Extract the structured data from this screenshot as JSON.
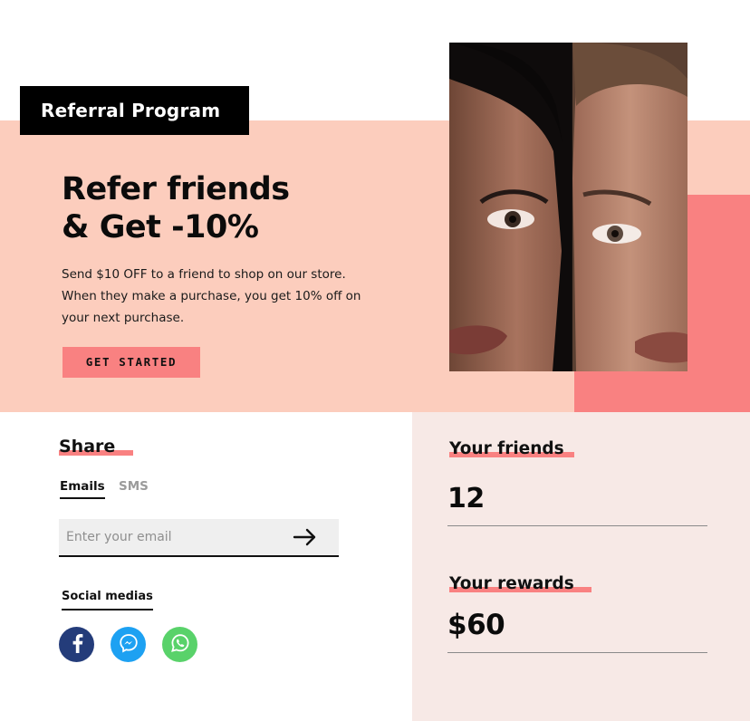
{
  "hero": {
    "tag": "Referral Program",
    "title_line1": "Refer friends",
    "title_line2": "& Get -10%",
    "desc_line1": "Send $10 OFF to a friend to shop on our store.",
    "desc_line2": "When they make a purchase, you get 10% off on",
    "desc_line3": "your next purchase.",
    "cta_label": "GET STARTED",
    "photo_icon": "two-women-portrait"
  },
  "share": {
    "title": "Share",
    "tabs": [
      "Emails",
      "SMS"
    ],
    "active_tab": "Emails",
    "email_placeholder": "Enter your email",
    "submit_icon": "arrow-right-icon",
    "social_title": "Social medias",
    "socials": [
      {
        "name": "facebook",
        "icon": "facebook-icon",
        "color": "#243c7a"
      },
      {
        "name": "messenger",
        "icon": "messenger-icon",
        "color": "#1da1f2"
      },
      {
        "name": "whatsapp",
        "icon": "whatsapp-icon",
        "color": "#59d26a"
      }
    ]
  },
  "stats": {
    "friends_label": "Your friends",
    "friends_value": "12",
    "rewards_label": "Your rewards",
    "rewards_value": "$60"
  },
  "colors": {
    "hero_bg": "#fccdbd",
    "accent": "#f98181",
    "panel_bg": "#f7e9e6",
    "tag_bg": "#000000"
  }
}
